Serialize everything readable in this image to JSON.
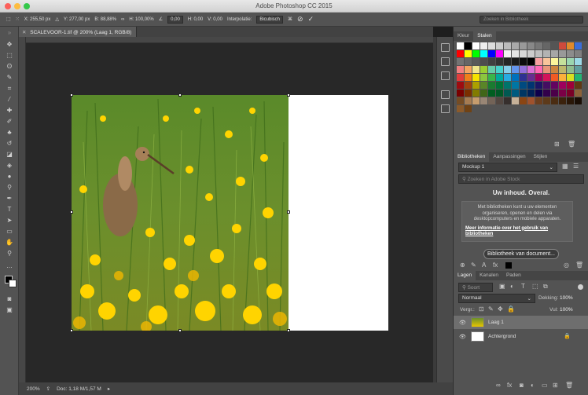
{
  "window": {
    "title": "Adobe Photoshop CC 2015",
    "traffic_lights": [
      "#fc605b",
      "#fdbc40",
      "#34c84a"
    ]
  },
  "options_bar": {
    "x_field": "X: 255,50 px",
    "y_field": "Y: 277,00 px",
    "w_field": "B: 88,88%",
    "h_field": "H: 100,00%",
    "angle_field": "0,00",
    "h_skew_label": "H: 0,00",
    "v_skew_label": "V: 0,00",
    "interpolation_label": "Interpolatie:",
    "interpolation_value": "Bicubisch",
    "search_placeholder": "Zoeken in Bibliotheek"
  },
  "document": {
    "tab_label": "SCALEVOOR-1.tif @ 200% (Laag 1, RGB/8)",
    "zoom": "200%",
    "doc_info": "Doc: 1,18 M/1,57 M",
    "canvas_bg": "#282828"
  },
  "swatches_panel": {
    "tabs": [
      "Kleur",
      "Stalen"
    ],
    "active_tab": "Stalen"
  },
  "libraries_panel": {
    "tabs": [
      "Bibliotheken",
      "Aanpassingen",
      "Stijlen"
    ],
    "library_name": "Mockup 1",
    "search_placeholder": "Zoeken in Adobe Stock",
    "headline": "Uw inhoud. Overal.",
    "body_text": "Met bibliotheken kunt u uw elementen organiseren, openen en delen via desktopcomputers en mobiele apparaten.",
    "more_info_link": "Meer informatie over het gebruik van bibliotheken",
    "button_label": "Bibliotheek van document..."
  },
  "layers_panel": {
    "tabs": [
      "Lagen",
      "Kanalen",
      "Paden"
    ],
    "filter_placeholder": "Soort",
    "blend_mode": "Normaal",
    "opacity_label": "Dekking:",
    "opacity_value": "100%",
    "lock_label": "Vergr.:",
    "fill_label": "Vul:",
    "fill_value": "100%",
    "layers": [
      {
        "name": "Laag 1",
        "selected": true
      },
      {
        "name": "Achtergrond",
        "selected": false
      }
    ]
  }
}
